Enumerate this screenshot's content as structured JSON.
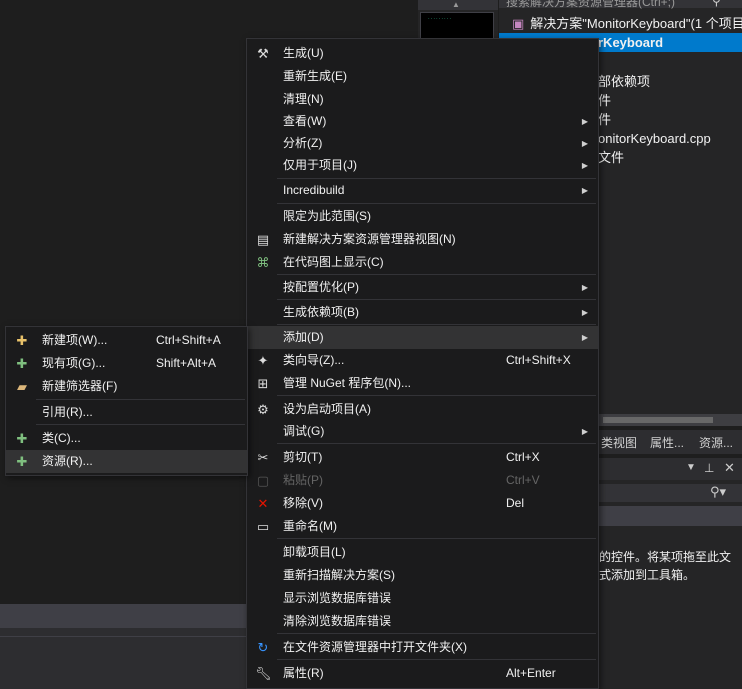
{
  "solution_explorer": {
    "search_text": "搜索解决方案资源管理器(Ctrl+;)",
    "rows": [
      {
        "label": "解决方案\"MonitorKeyboard\"(1 个项目"
      },
      {
        "label": "rKeyboard"
      },
      {
        "label": "部依赖项"
      },
      {
        "label": "件"
      },
      {
        "label": "件"
      },
      {
        "label": "onitorKeyboard.cpp"
      },
      {
        "label": "文件"
      }
    ],
    "tabs": [
      "类视图",
      "属性...",
      "资源..."
    ]
  },
  "toolbox": {
    "hint_line1": "的控件。将某项拖至此文",
    "hint_line2": "式添加到工具箱。"
  },
  "main_menu": {
    "items": [
      {
        "icon": "build-icon",
        "label": "生成(U)"
      },
      {
        "label": "重新生成(E)"
      },
      {
        "label": "清理(N)"
      },
      {
        "label": "查看(W)",
        "submenu": true
      },
      {
        "label": "分析(Z)",
        "submenu": true
      },
      {
        "label": "仅用于项目(J)",
        "submenu": true
      },
      {
        "label": "Incredibuild",
        "submenu": true
      },
      {
        "label": "限定为此范围(S)"
      },
      {
        "icon": "new-view-icon",
        "label": "新建解决方案资源管理器视图(N)"
      },
      {
        "icon": "code-map-icon",
        "label": "在代码图上显示(C)"
      },
      {
        "label": "按配置优化(P)",
        "submenu": true
      },
      {
        "label": "生成依赖项(B)",
        "submenu": true
      },
      {
        "label": "添加(D)",
        "submenu": true
      },
      {
        "icon": "class-wizard-icon",
        "label": "类向导(Z)...",
        "shortcut": "Ctrl+Shift+X"
      },
      {
        "icon": "nuget-icon",
        "label": "管理 NuGet 程序包(N)..."
      },
      {
        "icon": "gear-icon",
        "label": "设为启动项目(A)"
      },
      {
        "label": "调试(G)",
        "submenu": true
      },
      {
        "icon": "scissors-icon",
        "label": "剪切(T)",
        "shortcut": "Ctrl+X"
      },
      {
        "icon": "paste-icon",
        "label": "粘贴(P)",
        "shortcut": "Ctrl+V",
        "disabled": true
      },
      {
        "icon": "remove-icon",
        "label": "移除(V)",
        "shortcut": "Del"
      },
      {
        "icon": "rename-icon",
        "label": "重命名(M)"
      },
      {
        "label": "卸载项目(L)"
      },
      {
        "label": "重新扫描解决方案(S)"
      },
      {
        "label": "显示浏览数据库错误"
      },
      {
        "label": "清除浏览数据库错误"
      },
      {
        "icon": "refresh-folder-icon",
        "label": "在文件资源管理器中打开文件夹(X)"
      },
      {
        "icon": "wrench-icon",
        "label": "属性(R)",
        "shortcut": "Alt+Enter"
      }
    ]
  },
  "add_submenu": {
    "items": [
      {
        "icon": "new-item-icon",
        "label": "新建项(W)...",
        "shortcut": "Ctrl+Shift+A"
      },
      {
        "icon": "existing-item-icon",
        "label": "现有项(G)...",
        "shortcut": "Shift+Alt+A"
      },
      {
        "icon": "new-filter-icon",
        "label": "新建筛选器(F)"
      },
      {
        "label": "引用(R)..."
      },
      {
        "icon": "class-icon",
        "label": "类(C)..."
      },
      {
        "icon": "resource-icon",
        "label": "资源(R)..."
      }
    ]
  },
  "colors": {
    "selection": "#007acc",
    "menu_bg": "#1b1b1c",
    "remove_icon": "#e51400",
    "refresh_icon": "#3794ff"
  }
}
